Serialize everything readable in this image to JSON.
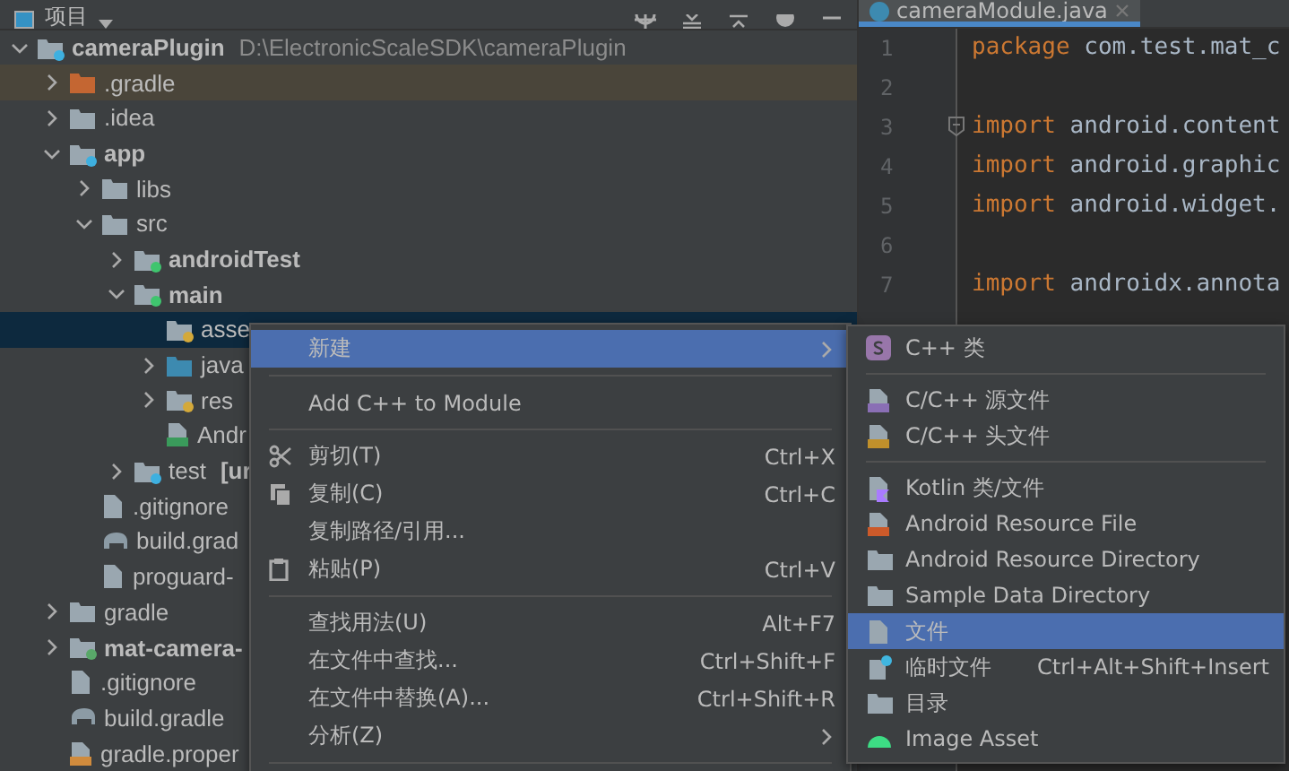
{
  "project_toolbar": {
    "title": "项目"
  },
  "tree": [
    {
      "name": "cameraPlugin",
      "path": "D:\\ElectronicScaleSDK\\cameraPlugin",
      "kind": "module",
      "expanded": true,
      "selected": false,
      "children": [
        {
          "name": ".gradle",
          "kind": "excluded",
          "expanded": false,
          "selected": false
        },
        {
          "name": ".idea",
          "kind": "folder",
          "expanded": false,
          "selected": false
        },
        {
          "name": "app",
          "kind": "module",
          "expanded": true,
          "selected": false,
          "children": [
            {
              "name": "libs",
              "kind": "folder",
              "expanded": false,
              "selected": false
            },
            {
              "name": "src",
              "kind": "folder",
              "expanded": true,
              "selected": false,
              "children": [
                {
                  "name": "androidTest",
                  "kind": "source",
                  "expanded": false,
                  "selected": false
                },
                {
                  "name": "main",
                  "kind": "source",
                  "expanded": true,
                  "selected": false,
                  "children": [
                    {
                      "name": "asse",
                      "kind": "resources",
                      "selected": true
                    },
                    {
                      "name": "java",
                      "kind": "java",
                      "expanded": false,
                      "selected": false
                    },
                    {
                      "name": "res",
                      "kind": "resources",
                      "expanded": false,
                      "selected": false
                    },
                    {
                      "name": "Andr",
                      "kind": "manifest",
                      "selected": false
                    }
                  ]
                },
                {
                  "name": "test",
                  "suffix": "[ur",
                  "kind": "test",
                  "expanded": false,
                  "selected": false
                }
              ]
            },
            {
              "name": ".gitignore",
              "kind": "ignore",
              "selected": false
            },
            {
              "name": "build.grad",
              "kind": "gradle",
              "selected": false
            },
            {
              "name": "proguard-",
              "kind": "text",
              "selected": false
            }
          ]
        },
        {
          "name": "gradle",
          "kind": "folder",
          "expanded": false,
          "selected": false
        },
        {
          "name": "mat-camera-",
          "kind": "library",
          "expanded": false,
          "selected": false
        },
        {
          "name": ".gitignore",
          "kind": "ignore",
          "selected": false
        },
        {
          "name": "build.gradle",
          "kind": "gradle",
          "selected": false
        },
        {
          "name": "gradle.proper",
          "kind": "properties",
          "selected": false
        }
      ]
    }
  ],
  "editor": {
    "tab": {
      "label": "cameraModule.java",
      "selected": true
    },
    "lines": [
      {
        "number": "1",
        "keyword": "package",
        "rest": " com.test.mat_c"
      },
      {
        "number": "2"
      },
      {
        "number": "3",
        "keyword": "import",
        "rest": " android.content",
        "fold": true
      },
      {
        "number": "4",
        "keyword": "import",
        "rest": " android.graphic"
      },
      {
        "number": "5",
        "keyword": "import",
        "rest": " android.widget."
      },
      {
        "number": "6"
      },
      {
        "number": "7",
        "keyword": "import",
        "rest": " androidx.annota"
      }
    ]
  },
  "context_menu": {
    "items": [
      {
        "kind": "item",
        "label": "新建",
        "submenu": true,
        "selected": true
      },
      {
        "kind": "separator"
      },
      {
        "kind": "item",
        "label": "Add C++ to Module",
        "selected": false
      },
      {
        "kind": "separator"
      },
      {
        "kind": "item",
        "label": "剪切(T)",
        "shortcut": "Ctrl+X",
        "selected": false
      },
      {
        "kind": "item",
        "label": "复制(C)",
        "shortcut": "Ctrl+C",
        "selected": false
      },
      {
        "kind": "item",
        "label": "复制路径/引用...",
        "selected": false
      },
      {
        "kind": "item",
        "label": "粘贴(P)",
        "shortcut": "Ctrl+V",
        "selected": false
      },
      {
        "kind": "separator"
      },
      {
        "kind": "item",
        "label": "查找用法(U)",
        "shortcut": "Alt+F7",
        "selected": false
      },
      {
        "kind": "item",
        "label": "在文件中查找...",
        "shortcut": "Ctrl+Shift+F",
        "selected": false
      },
      {
        "kind": "item",
        "label": "在文件中替换(A)...",
        "shortcut": "Ctrl+Shift+R",
        "selected": false
      },
      {
        "kind": "item",
        "label": "分析(Z)",
        "submenu": true,
        "selected": false
      },
      {
        "kind": "separator"
      }
    ]
  },
  "new_submenu": {
    "items": [
      {
        "kind": "item",
        "label": "C++ 类",
        "selected": false
      },
      {
        "kind": "separator"
      },
      {
        "kind": "item",
        "label": "C/C++ 源文件",
        "selected": false
      },
      {
        "kind": "item",
        "label": "C/C++ 头文件",
        "selected": false
      },
      {
        "kind": "separator"
      },
      {
        "kind": "item",
        "label": "Kotlin 类/文件",
        "selected": false
      },
      {
        "kind": "item",
        "label": "Android Resource File",
        "selected": false
      },
      {
        "kind": "item",
        "label": "Android Resource Directory",
        "selected": false
      },
      {
        "kind": "item",
        "label": "Sample Data Directory",
        "selected": false
      },
      {
        "kind": "item",
        "label": "文件",
        "selected": true
      },
      {
        "kind": "item",
        "label": "临时文件",
        "shortcut": "Ctrl+Alt+Shift+Insert",
        "selected": false
      },
      {
        "kind": "item",
        "label": "目录",
        "selected": false
      },
      {
        "kind": "item",
        "label": "Image Asset",
        "selected": false
      }
    ]
  }
}
